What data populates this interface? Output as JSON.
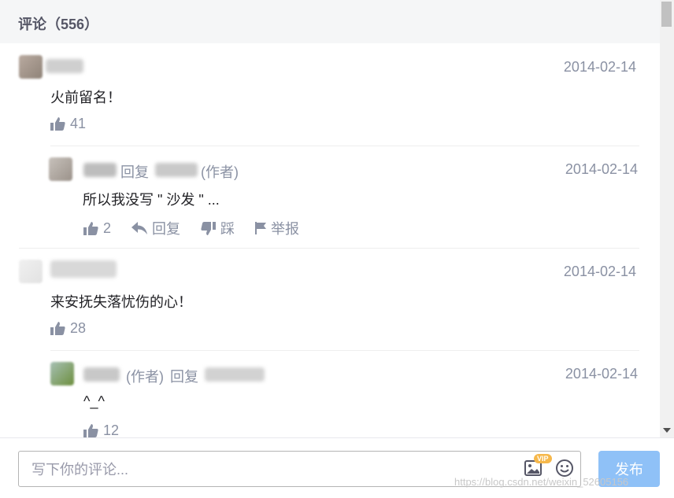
{
  "header": {
    "title": "评论（556）"
  },
  "comments": [
    {
      "date": "2014-02-14",
      "content": "火前留名！",
      "likes": "41"
    },
    {
      "reply_label": "回复",
      "author_tag": "(作者)",
      "date": "2014-02-14",
      "content": "所以我没写 \" 沙发 \" ...",
      "likes": "2",
      "reply_action": "回复",
      "dislike_action": "踩",
      "report_action": "举报"
    },
    {
      "date": "2014-02-14",
      "content": "来安抚失落忧伤的心！",
      "likes": "28"
    },
    {
      "author_tag": "(作者)",
      "reply_label": "回复",
      "date": "2014-02-14",
      "content": "^_^",
      "likes": "12"
    }
  ],
  "footer": {
    "input_placeholder": "写下你的评论...",
    "vip_badge": "VIP",
    "publish_label": "发布",
    "watermark": "https://blog.csdn.net/weixin_52605156"
  },
  "colors": {
    "accent": "#8fc1f7",
    "meta": "#8a91a3",
    "header_bg": "#f5f6f7"
  },
  "icons": [
    "thumbs-up-icon",
    "reply-arrow-icon",
    "thumbs-down-icon",
    "flag-icon",
    "image-icon",
    "emoji-icon"
  ]
}
